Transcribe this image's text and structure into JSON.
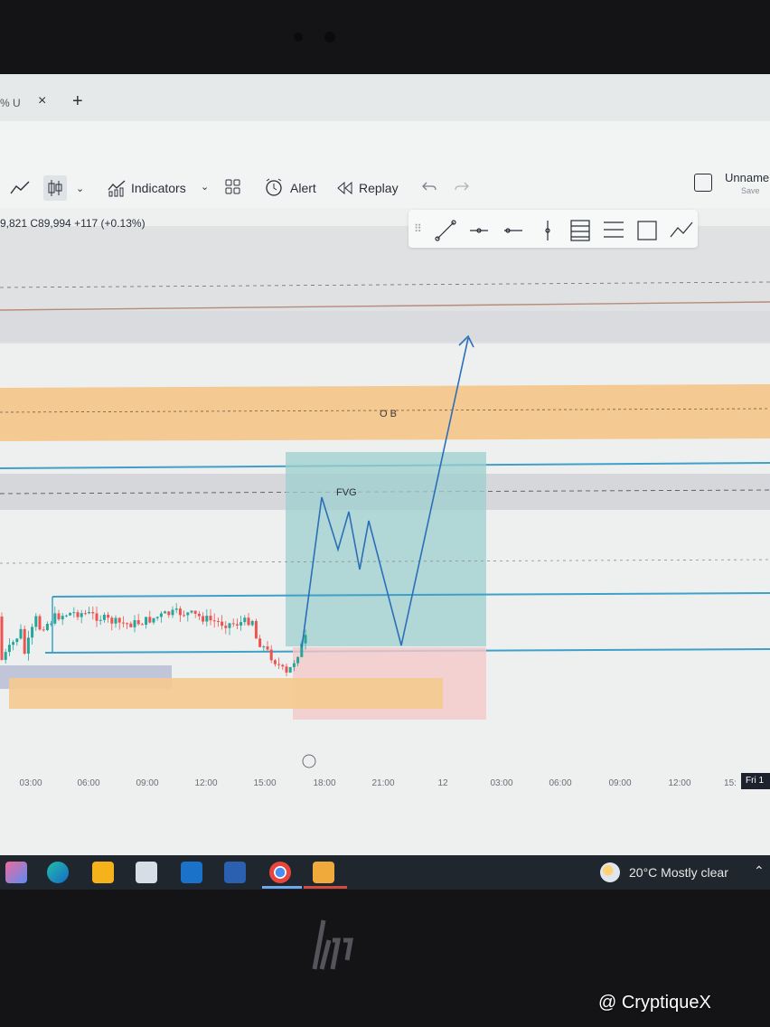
{
  "tab": {
    "title": "% U",
    "close": "×",
    "add": "+"
  },
  "toolbar": {
    "indicators_label": "Indicators",
    "alert_label": "Alert",
    "replay_label": "Replay",
    "layout_name": "Unname",
    "save_label": "Save"
  },
  "ohlc": {
    "text": "9,821  C89,994  +117 (+0.13%)"
  },
  "annotations": {
    "order_block": "O B",
    "fvg": "FVG"
  },
  "time_axis": [
    "03:00",
    "06:00",
    "09:00",
    "12:00",
    "15:00",
    "18:00",
    "21:00",
    "12",
    "03:00",
    "06:00",
    "09:00",
    "12:00",
    "15:"
  ],
  "time_badge": "Fri 1",
  "taskbar": {
    "weather": "20°C  Mostly clear"
  },
  "watermark": "@ CryptiqueX",
  "colors": {
    "ob_zone": "#f5c992",
    "fvg_box": "#9ecfcf",
    "horizontal_line": "#3fa0c8",
    "projection_line": "#2a6fb8",
    "demand_zone": "#f4c98e",
    "pink_zone": "#f4c9c9",
    "bull_candle": "#26a69a",
    "bear_candle": "#ef5350"
  },
  "icons": {
    "line_chart": "line-chart-icon",
    "candles": "candles-icon",
    "indicators": "indicators-icon",
    "templates": "grid-icon",
    "alert": "alarm-icon",
    "replay": "replay-icon",
    "undo": "undo-icon",
    "redo": "redo-icon"
  }
}
